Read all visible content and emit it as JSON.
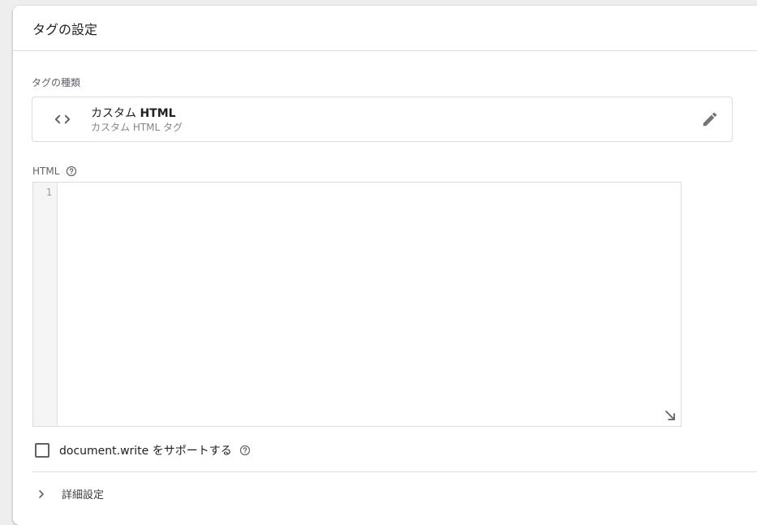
{
  "header": {
    "title": "タグの設定"
  },
  "tag_type": {
    "section_label": "タグの種類",
    "name_prefix": "カスタム",
    "name_bold": "HTML",
    "subtitle": "カスタム HTML タグ",
    "icon": "code-icon",
    "edit_icon": "pencil-icon"
  },
  "html_field": {
    "label": "HTML",
    "help_icon": "help-circle-icon",
    "line_numbers": [
      "1"
    ],
    "value": ""
  },
  "document_write": {
    "label": "document.write をサポートする",
    "checked": false,
    "help_icon": "help-circle-icon"
  },
  "advanced": {
    "label": "詳細設定",
    "icon": "chevron-right-icon"
  },
  "colors": {
    "card_bg": "#ffffff",
    "page_bg": "#eeeeee",
    "border": "#dadce0",
    "icon_gray": "#5f6368",
    "secondary_text": "#80868b"
  }
}
